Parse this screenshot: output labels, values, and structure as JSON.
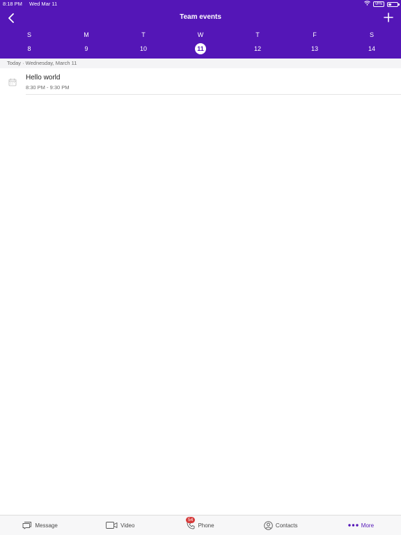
{
  "status_bar": {
    "time": "8:18 PM",
    "date": "Wed Mar 11",
    "vpn_label": "VPN",
    "icons": [
      "wifi-icon",
      "battery-icon"
    ]
  },
  "header": {
    "title": "Team events",
    "back_icon": "chevron-left-icon",
    "add_icon": "plus-icon",
    "background_color": "#5416b7"
  },
  "week": {
    "days": [
      "S",
      "M",
      "T",
      "W",
      "T",
      "F",
      "S"
    ],
    "dates": [
      "8",
      "9",
      "10",
      "11",
      "12",
      "13",
      "14"
    ],
    "selected_date": "11"
  },
  "section": {
    "label": "Today · Wednesday, March 11"
  },
  "events": [
    {
      "title": "Hello world",
      "time": "8:30 PM - 9:30 PM",
      "icon": "calendar-icon"
    }
  ],
  "tabbar": {
    "tabs": [
      {
        "label": "Message",
        "icon": "message-icon"
      },
      {
        "label": "Video",
        "icon": "video-icon"
      },
      {
        "label": "Phone",
        "icon": "phone-icon",
        "badge": "54"
      },
      {
        "label": "Contacts",
        "icon": "contacts-icon"
      },
      {
        "label": "More",
        "icon": "more-icon",
        "active": true
      }
    ],
    "accent_color": "#5416b7",
    "badge_color": "#d63b3b"
  }
}
